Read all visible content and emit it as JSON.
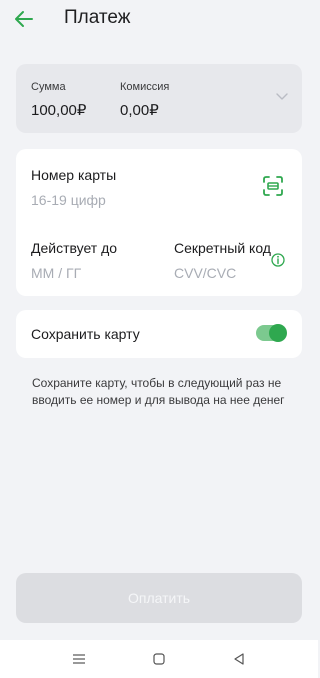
{
  "header": {
    "title": "Платеж",
    "back_icon": "arrow-left-icon",
    "accent_color": "#2fa84f"
  },
  "amount": {
    "sum_label": "Сумма",
    "sum_value": "100,00₽",
    "fee_label": "Комиссия",
    "fee_value": "0,00₽",
    "expand_icon": "chevron-down-icon"
  },
  "card_form": {
    "card_number_label": "Номер карты",
    "card_number_placeholder": "16-19 цифр",
    "card_number_value": "",
    "scan_icon": "card-scan-icon",
    "expiry_label": "Действует до",
    "expiry_placeholder": "ММ / ГГ",
    "expiry_value": "",
    "cvv_label": "Секретный код",
    "cvv_placeholder": "CVV/CVC",
    "cvv_value": "",
    "info_icon": "info-icon"
  },
  "save_card": {
    "label": "Сохранить карту",
    "enabled": true
  },
  "hint_text": "Сохраните карту, чтобы в следующий раз не вводить ее номер и для вывода на нее денег",
  "pay_button": {
    "label": "Оплатить",
    "disabled": true
  },
  "system_nav": {
    "items": [
      "menu-icon",
      "home-icon",
      "back-triangle-icon"
    ]
  }
}
